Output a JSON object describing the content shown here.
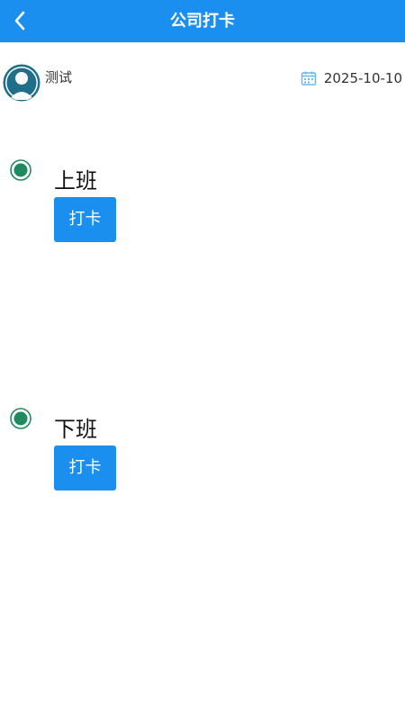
{
  "header": {
    "title": "公司打卡"
  },
  "user": {
    "name": "测试"
  },
  "date": "2025-10-10",
  "punches": [
    {
      "label": "上班",
      "button_label": "打卡"
    },
    {
      "label": "下班",
      "button_label": "打卡"
    }
  ],
  "colors": {
    "primary": "#1a8fef",
    "status_dot": "#1e8a5e",
    "calendar": "#6ab8e6",
    "avatar": "#1f6f8b"
  },
  "icons": {
    "back": "chevron-left-icon",
    "avatar": "user-avatar-icon",
    "calendar": "calendar-icon",
    "status": "status-dot-icon"
  }
}
